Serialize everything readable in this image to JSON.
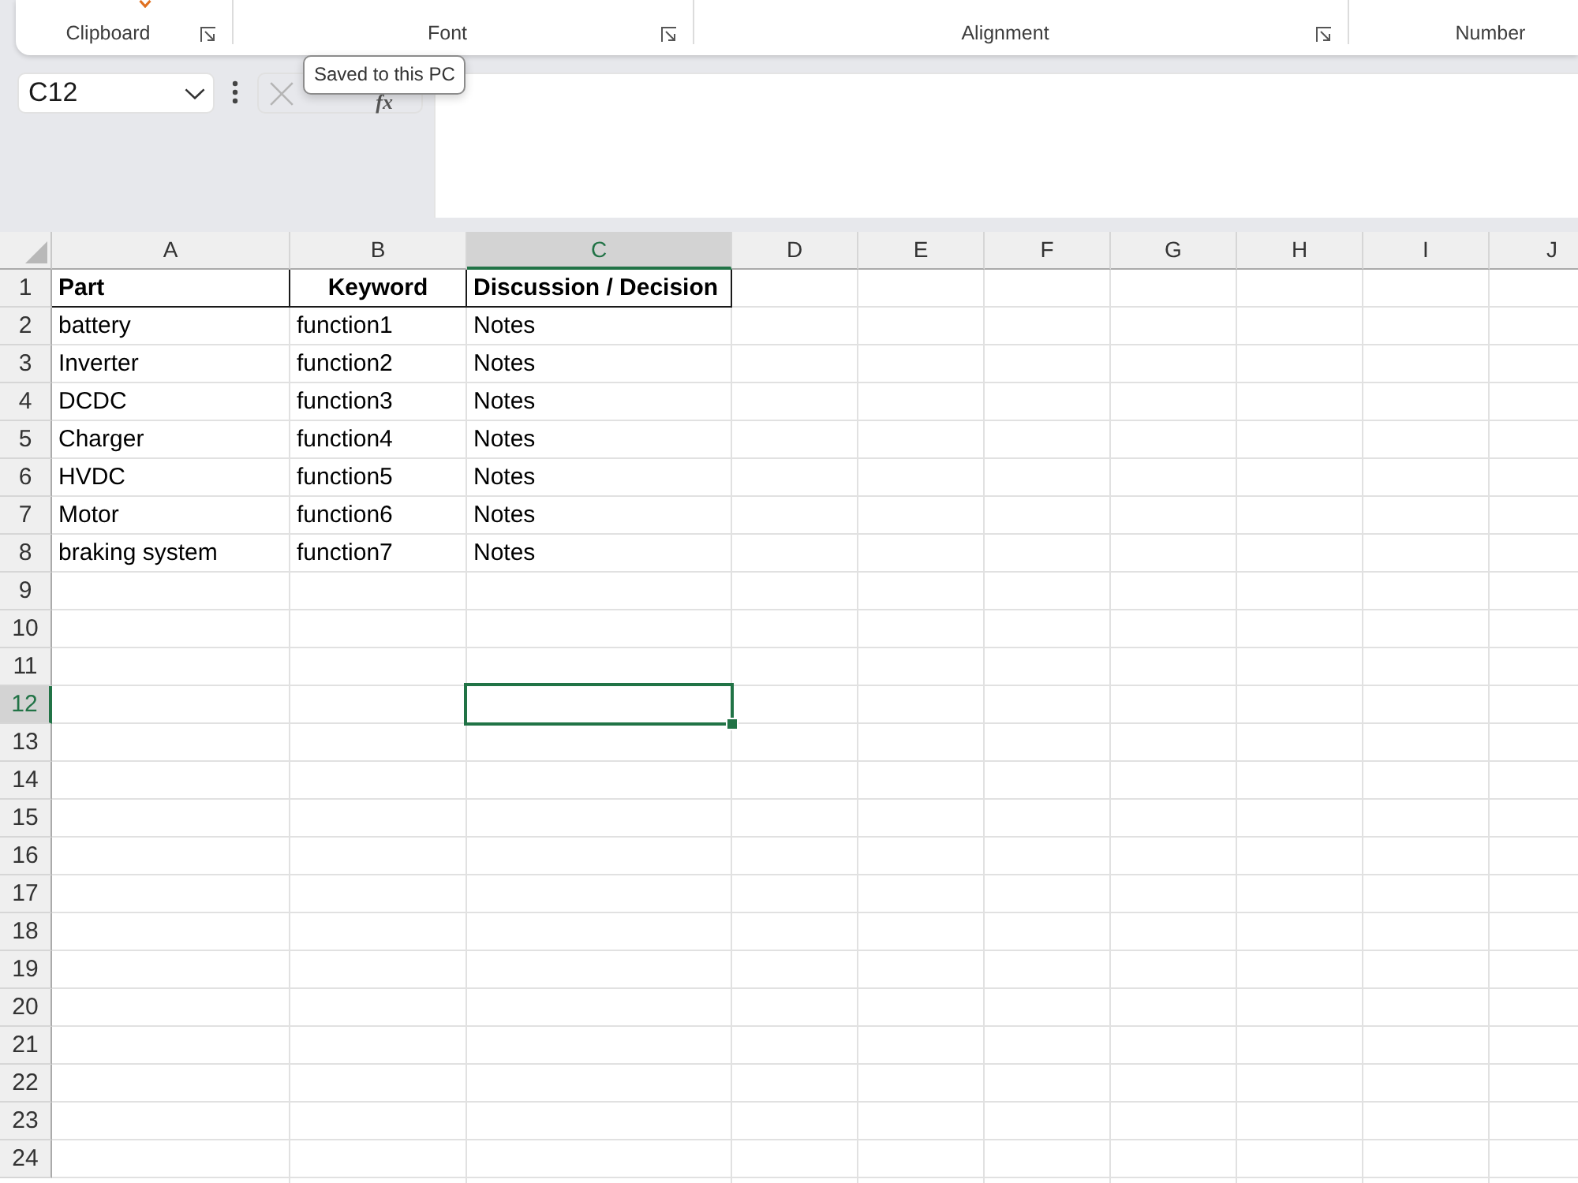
{
  "ribbon": {
    "groups": [
      {
        "label": "Clipboard"
      },
      {
        "label": "Font"
      },
      {
        "label": "Alignment"
      },
      {
        "label": "Number"
      }
    ]
  },
  "name_box": {
    "value": "C12"
  },
  "formula_bar": {
    "function_button": "fx"
  },
  "tooltip": {
    "text": "Saved to this PC"
  },
  "sheet": {
    "columns": [
      {
        "label": "A",
        "selected": false
      },
      {
        "label": "B",
        "selected": false
      },
      {
        "label": "C",
        "selected": true
      },
      {
        "label": "D",
        "selected": false
      },
      {
        "label": "E",
        "selected": false
      },
      {
        "label": "F",
        "selected": false
      },
      {
        "label": "G",
        "selected": false
      },
      {
        "label": "H",
        "selected": false
      },
      {
        "label": "I",
        "selected": false
      },
      {
        "label": "J",
        "selected": false
      }
    ],
    "rows": [
      {
        "label": "1",
        "selected": false,
        "kind": "header",
        "cells": [
          {
            "text": "Part",
            "centered": false
          },
          {
            "text": "Keyword",
            "centered": true
          },
          {
            "text": "Discussion / Decision",
            "centered": false
          }
        ]
      },
      {
        "label": "2",
        "selected": false,
        "kind": "data",
        "cells": [
          {
            "text": "battery"
          },
          {
            "text": "function1"
          },
          {
            "text": "Notes"
          }
        ]
      },
      {
        "label": "3",
        "selected": false,
        "kind": "data",
        "cells": [
          {
            "text": "Inverter"
          },
          {
            "text": "function2"
          },
          {
            "text": "Notes"
          }
        ]
      },
      {
        "label": "4",
        "selected": false,
        "kind": "data",
        "cells": [
          {
            "text": "DCDC"
          },
          {
            "text": "function3"
          },
          {
            "text": "Notes"
          }
        ]
      },
      {
        "label": "5",
        "selected": false,
        "kind": "data",
        "cells": [
          {
            "text": "Charger"
          },
          {
            "text": "function4"
          },
          {
            "text": "Notes"
          }
        ]
      },
      {
        "label": "6",
        "selected": false,
        "kind": "data",
        "cells": [
          {
            "text": "HVDC"
          },
          {
            "text": "function5"
          },
          {
            "text": "Notes"
          }
        ]
      },
      {
        "label": "7",
        "selected": false,
        "kind": "data",
        "cells": [
          {
            "text": "Motor"
          },
          {
            "text": "function6"
          },
          {
            "text": "Notes"
          }
        ]
      },
      {
        "label": "8",
        "selected": false,
        "kind": "data",
        "cells": [
          {
            "text": "braking system"
          },
          {
            "text": "function7"
          },
          {
            "text": "Notes"
          }
        ]
      },
      {
        "label": "9",
        "selected": false,
        "kind": "data"
      },
      {
        "label": "10",
        "selected": false,
        "kind": "data"
      },
      {
        "label": "11",
        "selected": false,
        "kind": "data"
      },
      {
        "label": "12",
        "selected": true,
        "kind": "data"
      },
      {
        "label": "13",
        "selected": false,
        "kind": "data"
      },
      {
        "label": "14",
        "selected": false,
        "kind": "data"
      },
      {
        "label": "15",
        "selected": false,
        "kind": "data"
      },
      {
        "label": "16",
        "selected": false,
        "kind": "data"
      },
      {
        "label": "17",
        "selected": false,
        "kind": "data"
      },
      {
        "label": "18",
        "selected": false,
        "kind": "data"
      },
      {
        "label": "19",
        "selected": false,
        "kind": "data"
      },
      {
        "label": "20",
        "selected": false,
        "kind": "data"
      },
      {
        "label": "21",
        "selected": false,
        "kind": "data"
      },
      {
        "label": "22",
        "selected": false,
        "kind": "data"
      },
      {
        "label": "23",
        "selected": false,
        "kind": "data"
      },
      {
        "label": "24",
        "selected": false,
        "kind": "data"
      }
    ]
  }
}
